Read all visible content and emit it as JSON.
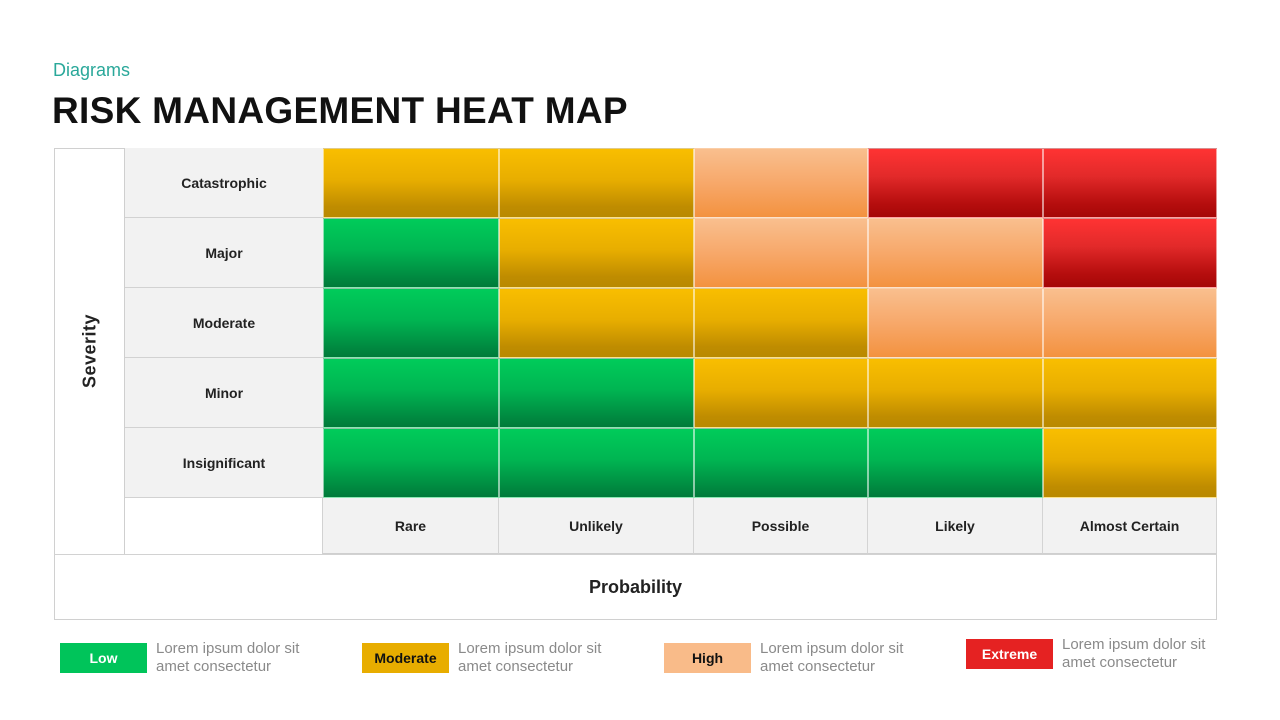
{
  "header": {
    "subtitle": "Diagrams",
    "title": "RISK MANAGEMENT HEAT MAP"
  },
  "axes": {
    "severity_label": "Severity",
    "probability_label": "Probability"
  },
  "severity_levels": [
    "Catastrophic",
    "Major",
    "Moderate",
    "Minor",
    "Insignificant"
  ],
  "probability_levels": [
    "Rare",
    "Unlikely",
    "Possible",
    "Likely",
    "Almost Certain"
  ],
  "risk_matrix": [
    [
      "moderate",
      "moderate",
      "high",
      "extreme",
      "extreme"
    ],
    [
      "low",
      "moderate",
      "high",
      "high",
      "extreme"
    ],
    [
      "low",
      "moderate",
      "moderate",
      "high",
      "high"
    ],
    [
      "low",
      "low",
      "moderate",
      "moderate",
      "moderate"
    ],
    [
      "low",
      "low",
      "low",
      "low",
      "moderate"
    ]
  ],
  "legend": [
    {
      "key": "low",
      "label": "Low",
      "color": "#00c45a",
      "text_color": "#ffffff",
      "line1": "Lorem ipsum dolor sit",
      "line2": "amet consectetur"
    },
    {
      "key": "moderate",
      "label": "Moderate",
      "color": "#e8ad00",
      "text_color": "#111111",
      "line1": "Lorem ipsum dolor sit",
      "line2": "amet consectetur"
    },
    {
      "key": "high",
      "label": "High",
      "color": "#f9bb89",
      "text_color": "#111111",
      "line1": "Lorem ipsum dolor sit",
      "line2": "amet consectetur"
    },
    {
      "key": "extreme",
      "label": "Extreme",
      "color": "#e52222",
      "text_color": "#ffffff",
      "line1": "Lorem ipsum dolor sit",
      "line2": "amet consectetur"
    }
  ],
  "chart_data": {
    "type": "heatmap",
    "title": "RISK MANAGEMENT HEAT MAP",
    "xlabel": "Probability",
    "ylabel": "Severity",
    "x": [
      "Rare",
      "Unlikely",
      "Possible",
      "Likely",
      "Almost Certain"
    ],
    "y": [
      "Catastrophic",
      "Major",
      "Moderate",
      "Minor",
      "Insignificant"
    ],
    "values": [
      [
        "Moderate",
        "Moderate",
        "High",
        "Extreme",
        "Extreme"
      ],
      [
        "Low",
        "Moderate",
        "High",
        "High",
        "Extreme"
      ],
      [
        "Low",
        "Moderate",
        "Moderate",
        "High",
        "High"
      ],
      [
        "Low",
        "Low",
        "Moderate",
        "Moderate",
        "Moderate"
      ],
      [
        "Low",
        "Low",
        "Low",
        "Low",
        "Moderate"
      ]
    ],
    "legend": [
      "Low",
      "Moderate",
      "High",
      "Extreme"
    ],
    "legend_position": "bottom"
  }
}
